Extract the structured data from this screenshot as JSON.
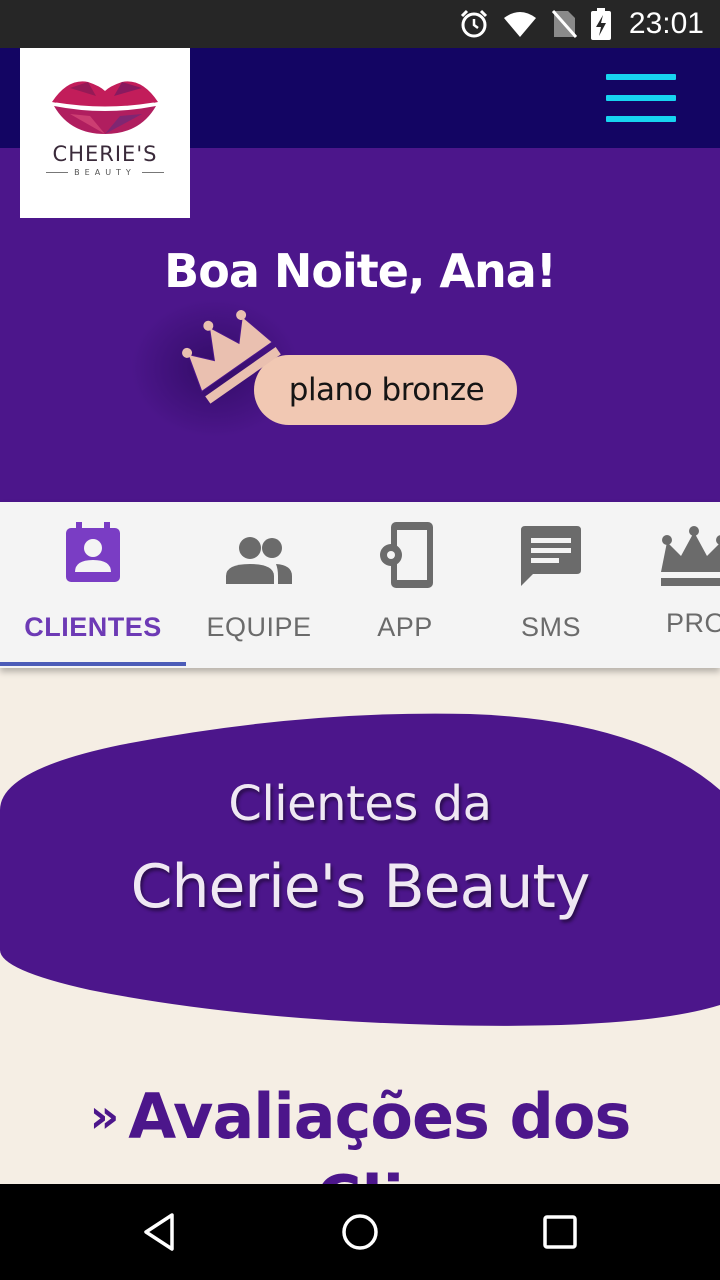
{
  "status_bar": {
    "time": "23:01",
    "icons": [
      "alarm-icon",
      "wifi-icon",
      "no-sim-icon",
      "battery-charging-icon"
    ]
  },
  "header": {
    "logo": {
      "name": "CHERIE'S",
      "sub": "BEAUTY"
    },
    "menu_icon": "hamburger-menu-icon",
    "menu_color": "#17d4f0"
  },
  "hero": {
    "greeting": "Boa Noite, Ana!",
    "plan_label": "plano bronze",
    "plan_icon": "crown-icon"
  },
  "tabs": [
    {
      "label": "CLIENTES",
      "icon": "client-card-icon",
      "active": true
    },
    {
      "label": "EQUIPE",
      "icon": "team-icon",
      "active": false
    },
    {
      "label": "APP",
      "icon": "phone-settings-icon",
      "active": false
    },
    {
      "label": "SMS",
      "icon": "message-icon",
      "active": false
    },
    {
      "label": "PRO",
      "icon": "crown-icon",
      "active": false
    }
  ],
  "content": {
    "title_line1": "Clientes da",
    "title_line2": "Cherie's Beauty",
    "section_prefix": "»",
    "section_title": "Avaliações dos",
    "section_title_cont": "Cli"
  },
  "colors": {
    "brand_purple": "#4c168b",
    "app_bar": "#130563",
    "plan_badge": "#f1c8b3",
    "background": "#f5eee4"
  },
  "nav_bar": [
    "back-icon",
    "home-icon",
    "recents-icon"
  ]
}
